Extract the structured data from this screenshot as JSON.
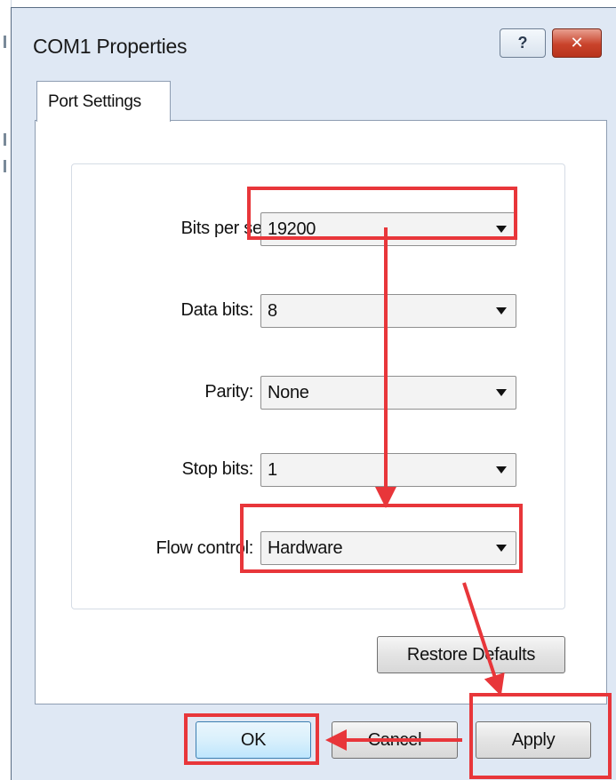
{
  "window": {
    "title": "COM1 Properties",
    "help_glyph": "?",
    "close_glyph": "✕"
  },
  "tabs": [
    {
      "label": "Port Settings",
      "selected": true
    }
  ],
  "fields": [
    {
      "label": "Bits per second",
      "value": "19200"
    },
    {
      "label": "Data bits:",
      "value": "8"
    },
    {
      "label": "Parity:",
      "value": "None"
    },
    {
      "label": "Stop bits:",
      "value": "1"
    },
    {
      "label": "Flow control:",
      "value": "Hardware"
    }
  ],
  "buttons": {
    "restore_defaults": "Restore Defaults",
    "ok": "OK",
    "cancel": "Cancel",
    "apply": "Apply"
  },
  "annotations": {
    "highlight_color": "#e8363a",
    "icons": [
      "red-arrow-icon"
    ]
  }
}
